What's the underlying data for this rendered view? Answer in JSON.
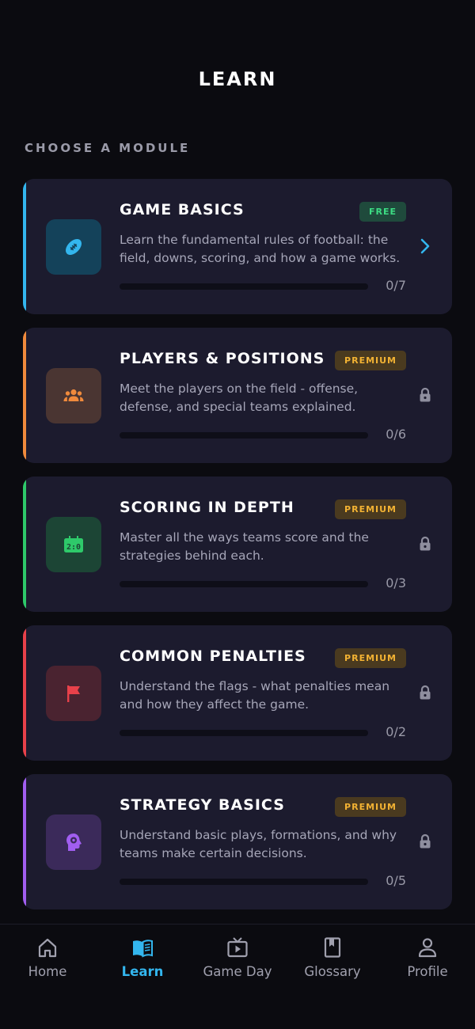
{
  "header": {
    "title": "LEARN"
  },
  "section": {
    "label": "CHOOSE A MODULE"
  },
  "modules": [
    {
      "title": "GAME BASICS",
      "badge": "FREE",
      "description": "Learn the fundamental rules of football: the field, downs, scoring, and how a game works.",
      "progress": "0/7",
      "completed": 0,
      "total": 7,
      "accent_color": "#33b6ee",
      "icon": "football-icon",
      "locked": false
    },
    {
      "title": "PLAYERS & POSITIONS",
      "badge": "PREMIUM",
      "description": "Meet the players on the field - offense, defense, and special teams explained.",
      "progress": "0/6",
      "completed": 0,
      "total": 6,
      "accent_color": "#f08a3c",
      "icon": "group-icon",
      "locked": true
    },
    {
      "title": "SCORING IN DEPTH",
      "badge": "PREMIUM",
      "description": "Master all the ways teams score and the strategies behind each.",
      "progress": "0/3",
      "completed": 0,
      "total": 3,
      "accent_color": "#2ec96a",
      "icon": "scoreboard-icon",
      "locked": true
    },
    {
      "title": "COMMON PENALTIES",
      "badge": "PREMIUM",
      "description": "Understand the flags - what penalties mean and how they affect the game.",
      "progress": "0/2",
      "completed": 0,
      "total": 2,
      "accent_color": "#e8414a",
      "icon": "flag-icon",
      "locked": true
    },
    {
      "title": "STRATEGY BASICS",
      "badge": "PREMIUM",
      "description": "Understand basic plays, formations, and why teams make certain decisions.",
      "progress": "0/5",
      "completed": 0,
      "total": 5,
      "accent_color": "#a15ef0",
      "icon": "strategy-head-icon",
      "locked": true
    }
  ],
  "bottom_nav": {
    "items": [
      {
        "label": "Home",
        "icon": "home-icon",
        "active": false
      },
      {
        "label": "Learn",
        "icon": "book-icon",
        "active": true
      },
      {
        "label": "Game Day",
        "icon": "tv-play-icon",
        "active": false
      },
      {
        "label": "Glossary",
        "icon": "bookmark-book-icon",
        "active": false
      },
      {
        "label": "Profile",
        "icon": "person-icon",
        "active": false
      }
    ]
  },
  "colors": {
    "background": "#0b0b10",
    "card": "#1c1b2e",
    "active_tab": "#33b6ee",
    "free_badge_text": "#3ddc84",
    "premium_badge_text": "#f2b233"
  }
}
